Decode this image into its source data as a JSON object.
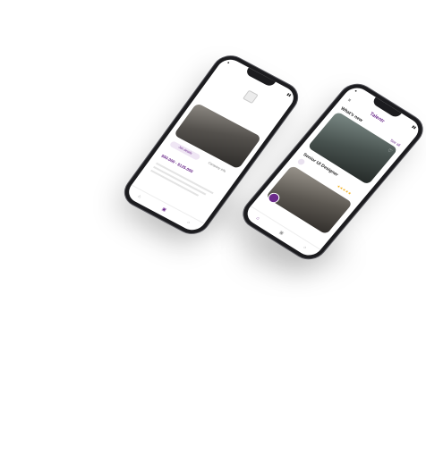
{
  "phones": [
    {
      "id": "phoneA",
      "card": {
        "price": "$50.000 - $125.000",
        "primary_label": "Job details",
        "secondary_label": "Company info"
      }
    },
    {
      "id": "phoneB",
      "header": {
        "brand": "Talentr",
        "section": "What's new",
        "see_all": "See all"
      },
      "card": {
        "title": "Senior UI Designer"
      }
    }
  ],
  "colors": {
    "accent": "#6b2b8a",
    "background": "#ffffff",
    "phone_frame": "#1c1c1f"
  }
}
